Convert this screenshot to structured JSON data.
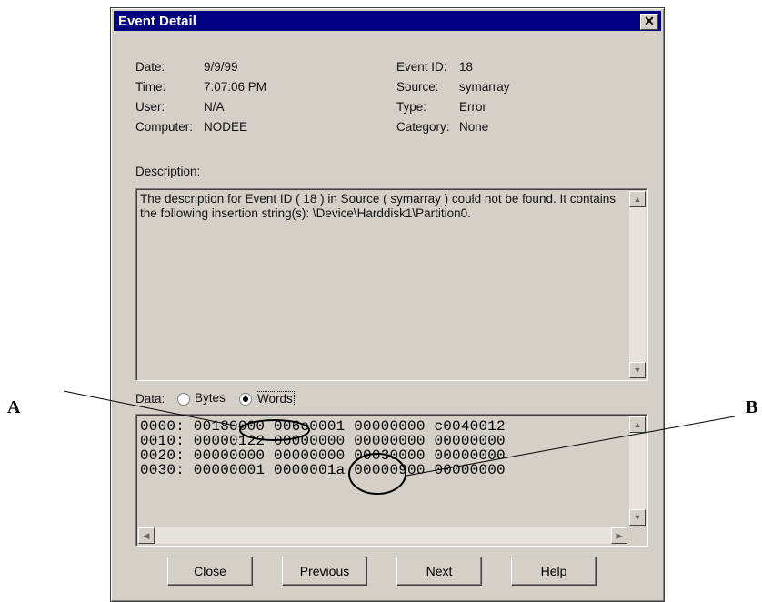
{
  "window": {
    "title": "Event Detail",
    "close_glyph": "✕"
  },
  "fields": {
    "date_label": "Date:",
    "date_value": "9/9/99",
    "time_label": "Time:",
    "time_value": "7:07:06 PM",
    "user_label": "User:",
    "user_value": "N/A",
    "computer_label": "Computer:",
    "computer_value": "NODEE",
    "eventid_label": "Event ID:",
    "eventid_value": "18",
    "source_label": "Source:",
    "source_value": "symarray",
    "type_label": "Type:",
    "type_value": "Error",
    "category_label": "Category:",
    "category_value": "None"
  },
  "description": {
    "label": "Description:",
    "text": "The description for Event ID ( 18 ) in Source ( symarray ) could not be found. It contains the following insertion string(s): \\Device\\Harddisk1\\Partition0."
  },
  "data_section": {
    "label": "Data:",
    "format_options": [
      {
        "label": "Bytes",
        "selected": false
      },
      {
        "label": "Words",
        "selected": true
      }
    ],
    "rows": [
      "0000: 00180000 006e0001 00000000 c0040012",
      "0010: 00000122 00000000 00000000 00000000",
      "0020: 00000000 00000000 00030000 00000000",
      "0030: 00000001 0000001a 00000900 00000000"
    ]
  },
  "buttons": {
    "close": "Close",
    "previous": "Previous",
    "next": "Next",
    "help": "Help"
  },
  "annotations": {
    "a": "A",
    "b": "B"
  },
  "icons": [
    "close-icon",
    "scroll-up-icon",
    "scroll-down-icon",
    "scroll-left-icon",
    "scroll-right-icon"
  ],
  "colors": {
    "titlebar": "#000080",
    "face": "#d4d0c8"
  }
}
